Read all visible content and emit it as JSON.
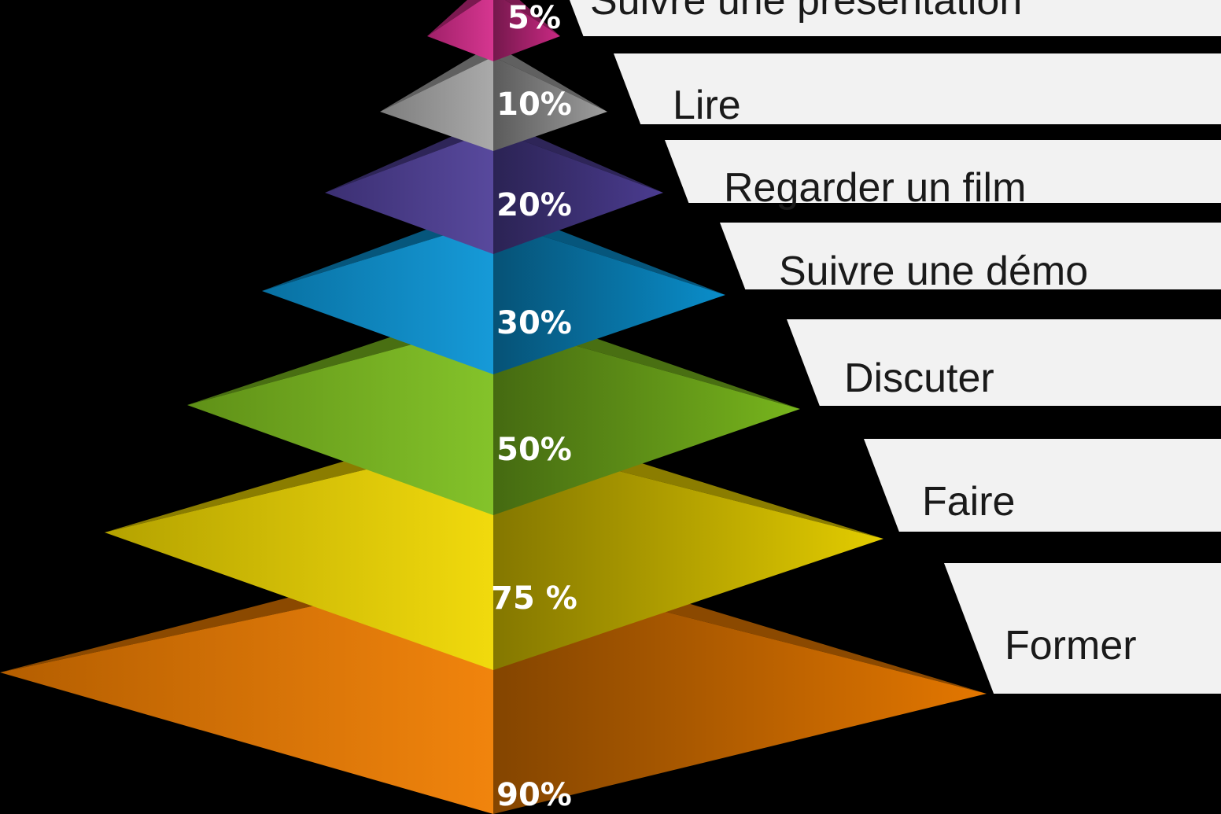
{
  "levels": [
    {
      "label": "Suivre une présentation",
      "percent": "5%",
      "color": "#d42b8a"
    },
    {
      "label": "Lire",
      "percent": "10%",
      "color": "#a6a6a6"
    },
    {
      "label": "Regarder un film",
      "percent": "20%",
      "color": "#4f3f98"
    },
    {
      "label": "Suivre une démo",
      "percent": "30%",
      "color": "#0a95d6"
    },
    {
      "label": "Discuter",
      "percent": "50%",
      "color": "#7ec01f"
    },
    {
      "label": "Faire",
      "percent": "75 %",
      "color": "#f0d800"
    },
    {
      "label": "Former",
      "percent": "90%",
      "color": "#f07d00"
    }
  ],
  "colors": {
    "background": "#000000",
    "label_box": "#f2f2f2",
    "label_text": "#1a1a1a",
    "percent_text": "#ffffff"
  }
}
